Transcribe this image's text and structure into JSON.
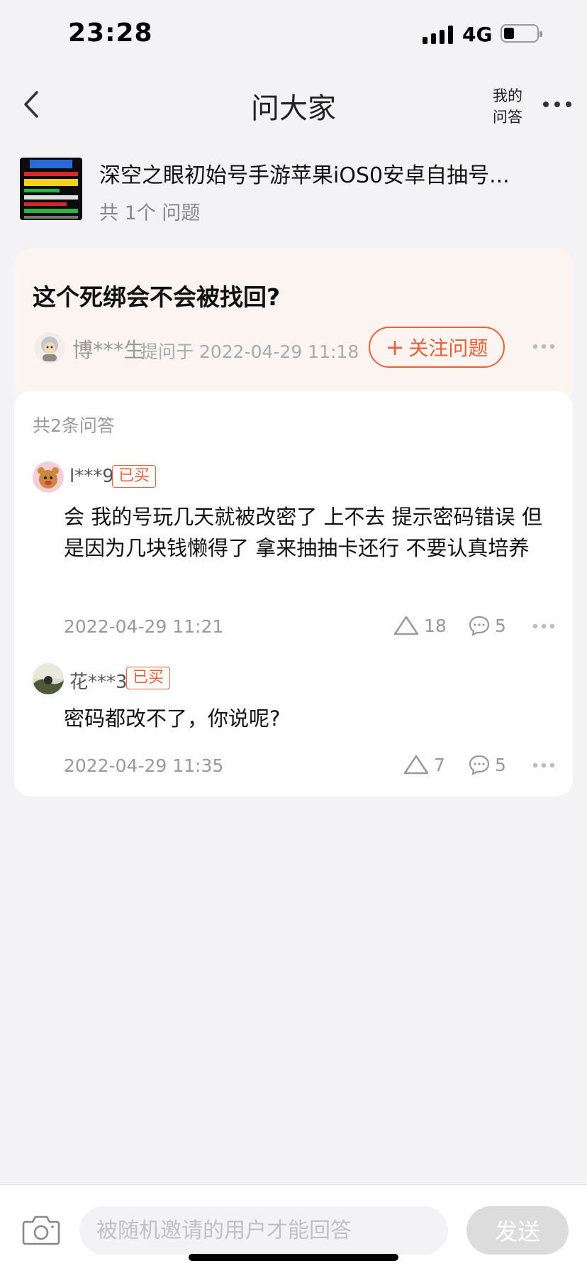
{
  "status": {
    "time": "23:28",
    "network": "4G",
    "battery_level": 0.25
  },
  "nav": {
    "title": "问大家",
    "my_questions": "我的\n问答"
  },
  "product": {
    "title": "深空之眼初始号手游苹果iOS0安卓自抽号...",
    "question_count": "共 1个 问题"
  },
  "question": {
    "title": "这个死绑会不会被找回?",
    "asker": "博***生",
    "ask_time": "提问于 2022-04-29 11:18",
    "follow_label": "关注问题"
  },
  "answers": {
    "count_label": "共2条问答",
    "items": [
      {
        "user": "l***9",
        "badge": "已买",
        "text": "会 我的号玩几天就被改密了 上不去 提示密码错误 但是因为几块钱懒得了 拿来抽抽卡还行 不要认真培养",
        "time": "2022-04-29 11:21",
        "likes": "18",
        "comments": "5"
      },
      {
        "user": "花***3",
        "badge": "已买",
        "text": "密码都改不了，你说呢?",
        "time": "2022-04-29 11:35",
        "likes": "7",
        "comments": "5"
      }
    ]
  },
  "bottom": {
    "placeholder": "被随机邀请的用户才能回答",
    "send_label": "发送"
  },
  "colors": {
    "accent": "#e8603a",
    "background": "#f3f2f4",
    "question_card": "#fcf4f1"
  }
}
